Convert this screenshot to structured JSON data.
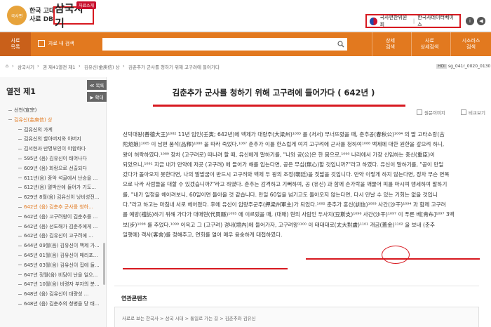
{
  "header": {
    "logo_text_line1": "한국 고대",
    "logo_text_line2": "사료 DB",
    "logo_mark_text": "국사편",
    "brand": "삼국사기",
    "brand_badge": "자료소개",
    "agency_name": "국사편찬위원회",
    "agency_sub": "한국사데이터베이스",
    "info_icon": "i",
    "speaker_icon": "◀"
  },
  "nav": {
    "menu_label_1": "사료",
    "menu_label_2": "목록",
    "checkbox_label": "자료 내 검색",
    "search_placeholder": "",
    "right_items": [
      {
        "line1": "상세",
        "line2": "검색"
      },
      {
        "line1": "사료",
        "line2": "상세검색"
      },
      {
        "line1": "시소러스",
        "line2": "검색"
      }
    ]
  },
  "breadcrumb": {
    "items": [
      "삼국사기",
      "권 제41열전 제1",
      "김유신(金庾信) 상",
      "김춘추가 군사를 청하기 위해 고구려에 들어가다"
    ],
    "hoi_label": "HOI",
    "hoi_code": "sg_041r_0020_0130"
  },
  "sidebar": {
    "title": "열전 제1",
    "btn_prev": "≪ 목록",
    "btn_next": "▶ 확대",
    "items": [
      {
        "label": "선천(宣宗)",
        "level": 0,
        "active": false
      },
      {
        "label": "김유신(金庾信) 상",
        "level": 0,
        "active": true
      },
      {
        "label": "김유신의 가계",
        "level": 1,
        "active": false
      },
      {
        "label": "김유신의 할아버지와 아버지",
        "level": 1,
        "active": false
      },
      {
        "label": "김서현과 만명부인이 야합하다",
        "level": 1,
        "active": false
      },
      {
        "label": "595년 (음) 김유신이 태어나다",
        "level": 1,
        "active": false
      },
      {
        "label": "609년 (음) 화랑으로 선출되다",
        "level": 1,
        "active": false
      },
      {
        "label": "611년(음) 중악 석굴에서 난승을 ...",
        "level": 1,
        "active": false
      },
      {
        "label": "612년(음) 열박산에 들어가 기도...",
        "level": 1,
        "active": false
      },
      {
        "label": "629년 8월(음) 김유신이 낭비성전...",
        "level": 1,
        "active": false
      },
      {
        "label": "642년 (음) 김춘추 군사를 청하...",
        "level": 1,
        "active": true
      },
      {
        "label": "642년 (음) 고구려왕이 김춘추를 ...",
        "level": 1,
        "active": false
      },
      {
        "label": "642년 (음) 선도해가 김춘추에게 ...",
        "level": 1,
        "active": false
      },
      {
        "label": "642년 (음) 김유신이 고구려에 ...",
        "level": 1,
        "active": false
      },
      {
        "label": "644년 09월(음) 김유신이 백제 가...",
        "level": 1,
        "active": false
      },
      {
        "label": "645년 01월(음) 김유신이 매리포...",
        "level": 1,
        "active": false
      },
      {
        "label": "645년 03월(음) 김유신이 집에 들...",
        "level": 1,
        "active": false
      },
      {
        "label": "647년 정월(음) 비담이 난을 일으...",
        "level": 1,
        "active": false
      },
      {
        "label": "647년 10월(음) 비령자 부자의 분...",
        "level": 1,
        "active": false
      },
      {
        "label": "648년 (음) 김유신이 대량성 ...",
        "level": 1,
        "active": false
      },
      {
        "label": "648년 (음) 김춘추의 청병을 당 태...",
        "level": 1,
        "active": false
      }
    ]
  },
  "article": {
    "title": "김춘추가 군사를 청하기 위해 고구려에 들어가다 ( 642년 )",
    "tool_original": "원문이미지",
    "tool_compare": "비교보기",
    "lines": [
      "선덕대왕(善德大王)¹⁰⁸² 11년 임인(壬寅; 642년)에 백제가 대량주(大梁州)¹⁰⁸³ 를 (처서) 무너뜨렸을 때, 춘추공(春秋公)¹⁰⁸⁴ 의 딸 고타소랑(古",
      "陀炤娘)¹⁰⁸⁵ 이 남편 품석(品釋)¹⁰⁸⁶ 을 따라 죽었다.¹⁰⁸⁷ 춘추가 이를 한스럽게 여겨 고구려에 군사를 청하여¹⁰⁸⁸ 백제에 대한 원한을 갚으려 하니,",
      "왕이 허락하였다.¹⁰⁸⁹ 장차 (고구려로) 떠나려 할 때, 유신에게 말하기를, \"나와 공(公)은 한 몸으로,¹⁰⁹⁰ 나라에서 가장 신임하는 중신(重臣)이",
      "되었으니,¹⁰⁹¹ 지금 내가 만약에 저곳 (고구려) 에 들어가 해를 입는다면, 공은 무심(無心)할 것입니까?\"라고 하였다. 유신이 말하기를, \"공이 만일",
      "갔다가 돌아오지 못한다면, 나의 말발굽이 반드시 고구려와 백제 두 왕의 조정(朝廷)을 짓밟을 것입니다. 만약 이렇게 하지 않는다면, 장차 무슨 면목",
      "으로 나라 사람들을 대할 수 있겠습니까?\"라고 하였다. 춘추는 감격하고 기뻐하여, 공 (유신) 과 함께 손가락을 깨물어 피를 마시며 맹세하여 말하기",
      "를, \"내가 일정을 헤아려보니, 60일이면 돌아올 것 같습니다. 만일 60일을 넘기고도 돌아오지 않는다면, 다시 만날 수 있는 기회는 없을 것입니",
      "다.\"라고 하고는 마침내 서로 헤어졌다. 후에 유신이 압량주군주(押梁州軍主)가 되었다.¹⁰⁹² 춘추가 훈신(訓信)¹⁰⁹³ 사간(沙干)¹⁰⁹⁴ 과 함께 고구려",
      "를 예방(禮訪)하기 위해 가다가 대매현(代買縣)¹⁰⁹⁵ 에 이르렀을 때, (대매) 현의 사람인 두사지(豆斯支)¹⁰⁹⁶ 사간(沙干)¹⁰⁹⁷ 이 푸른 베[靑布]¹⁰⁹⁷ 3백",
      "보(步)¹⁰⁹⁸ 를 주었다.¹⁰⁹⁹ 이윽고 그 (고구려) 경내(境內)에 들어가자, 고구려왕¹¹⁰⁰ 이 태대대로(太大對盧)¹¹⁰¹ 개금(蓋金)¹¹⁰² 을 보내 (춘추",
      "일행에) 객사(客舍)를 정해주고, 연회를 열어 매우 융숭하게 대접하였다."
    ]
  },
  "related": {
    "title": "연관콘텐츠",
    "link": "사료로 보는 한국사 > 삼국 시대 > 통일로 가는 길 > 김춘추와 김유신"
  }
}
